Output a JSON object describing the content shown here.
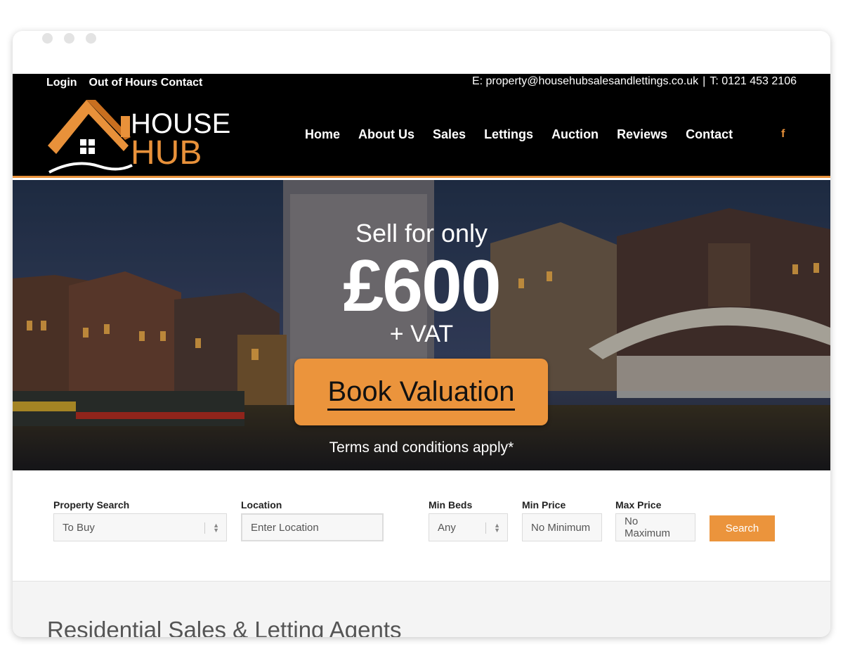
{
  "header": {
    "top_links": [
      "Login",
      "Out of Hours Contact"
    ],
    "email": "E: property@househubsalesandlettings.co.uk",
    "separator": "|",
    "phone": "T: 0121 453 2106",
    "logo_line1": "HOUSE",
    "logo_line2": "HUB",
    "nav": [
      "Home",
      "About Us",
      "Sales",
      "Lettings",
      "Auction",
      "Reviews",
      "Contact"
    ],
    "social_icon": "f"
  },
  "hero": {
    "line1": "Sell for only",
    "price": "£600",
    "vat": "+ VAT",
    "button": "Book Valuation",
    "terms": "Terms and conditions apply*"
  },
  "search": {
    "property_search_label": "Property Search",
    "property_search_value": "To Buy",
    "location_label": "Location",
    "location_placeholder": "Enter Location",
    "min_beds_label": "Min Beds",
    "min_beds_value": "Any",
    "min_price_label": "Min Price",
    "min_price_value": "No Minimum",
    "max_price_label": "Max Price",
    "max_price_value": "No Maximum",
    "search_button": "Search"
  },
  "intro": {
    "heading": "Residential Sales & Letting Agents"
  },
  "colors": {
    "accent": "#eb943c",
    "header_bg": "#000000"
  }
}
